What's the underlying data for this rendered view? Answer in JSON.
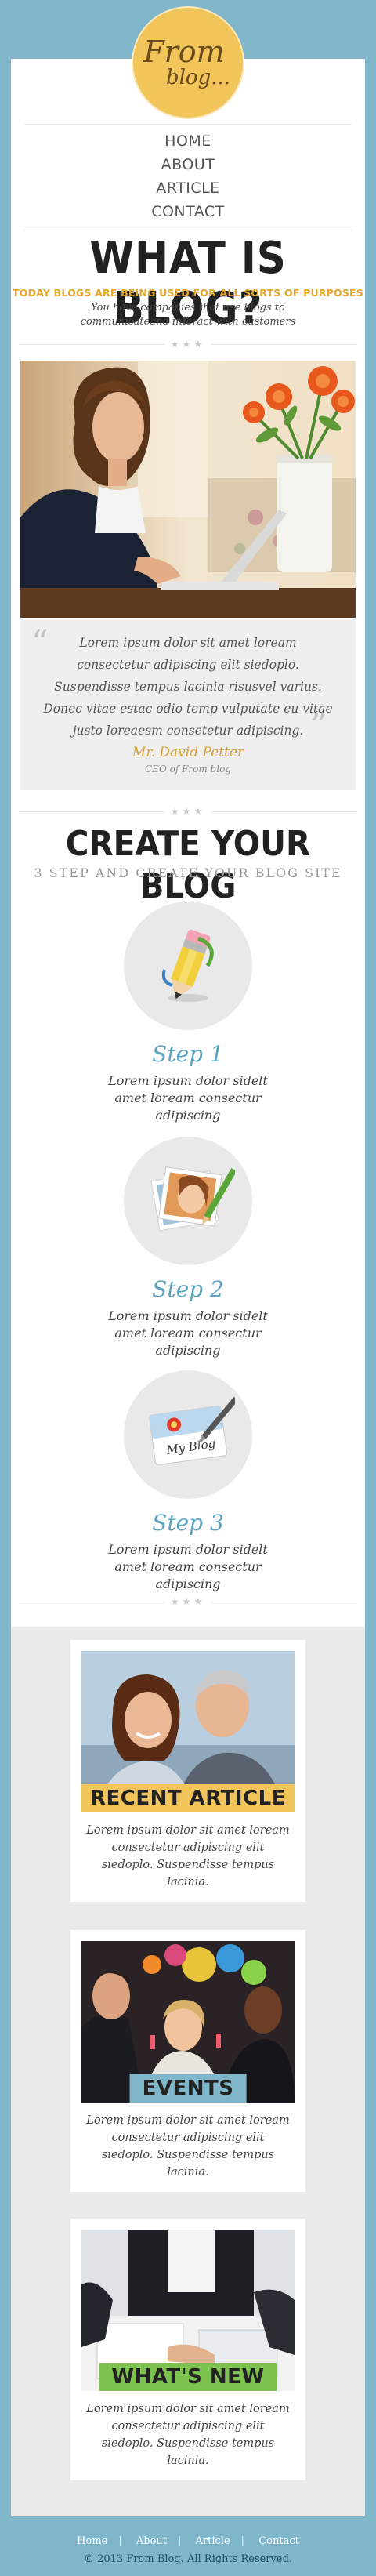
{
  "logo": {
    "line1": "From",
    "line2": "blog..."
  },
  "nav": {
    "items": [
      "HOME",
      "ABOUT",
      "ARTICLE",
      "CONTACT"
    ]
  },
  "hero": {
    "title": "WHAT IS BLOG?",
    "subtitle": "TODAY BLOGS ARE BEING USED FOR ALL SORTS OF PURPOSES",
    "description": "You have companies that use blogs to communicateand interact with customers"
  },
  "divider_stars": "★★★",
  "quote": {
    "text": "Lorem ipsum dolor sit amet loream consectetur adipiscing elit siedoplo. Suspendisse tempus lacinia risusvel varius. Donec vitae estac odio temp vulputate eu vitae justo loreaesm consetetur adipiscing.",
    "author": "Mr. David Petter",
    "role": "CEO of From blog"
  },
  "create": {
    "title": "CREATE YOUR BLOG",
    "subtitle": "3 STEP AND CREATE YOUR BLOG SITE",
    "steps": [
      {
        "title": "Step 1",
        "desc": "Lorem ipsum dolor sidelt amet loream consectur adipiscing",
        "icon": "pencil-icon"
      },
      {
        "title": "Step 2",
        "desc": "Lorem ipsum dolor sidelt amet loream consectur adipiscing",
        "icon": "photos-icon"
      },
      {
        "title": "Step 3",
        "desc": "Lorem ipsum dolor sidelt amet loream consectur adipiscing",
        "icon": "my-blog-card-icon",
        "card_text": "My Blog"
      }
    ]
  },
  "cards": [
    {
      "label": "RECENT ARTICLE",
      "color": "#f2c55a",
      "text": "Lorem ipsum dolor sit amet loream consectetur adipiscing elit siedoplo. Suspendisse tempus lacinia."
    },
    {
      "label": "EVENTS",
      "color": "#7fb6ca",
      "text": "Lorem ipsum dolor sit amet loream consectetur adipiscing elit siedoplo. Suspendisse tempus lacinia."
    },
    {
      "label": "WHAT'S NEW",
      "color": "#7cc24e",
      "text": "Lorem ipsum dolor sit amet loream consectetur adipiscing elit siedoplo. Suspendisse tempus lacinia."
    }
  ],
  "footer": {
    "links": [
      "Home",
      "About",
      "Article",
      "Contact"
    ],
    "copyright": "© 2013 From Blog. All Rights Reserved."
  },
  "colors": {
    "accent_blue": "#7fb6ca",
    "accent_yellow": "#f2c55a",
    "accent_green": "#7cc24e",
    "gold_text": "#e3a72f"
  }
}
